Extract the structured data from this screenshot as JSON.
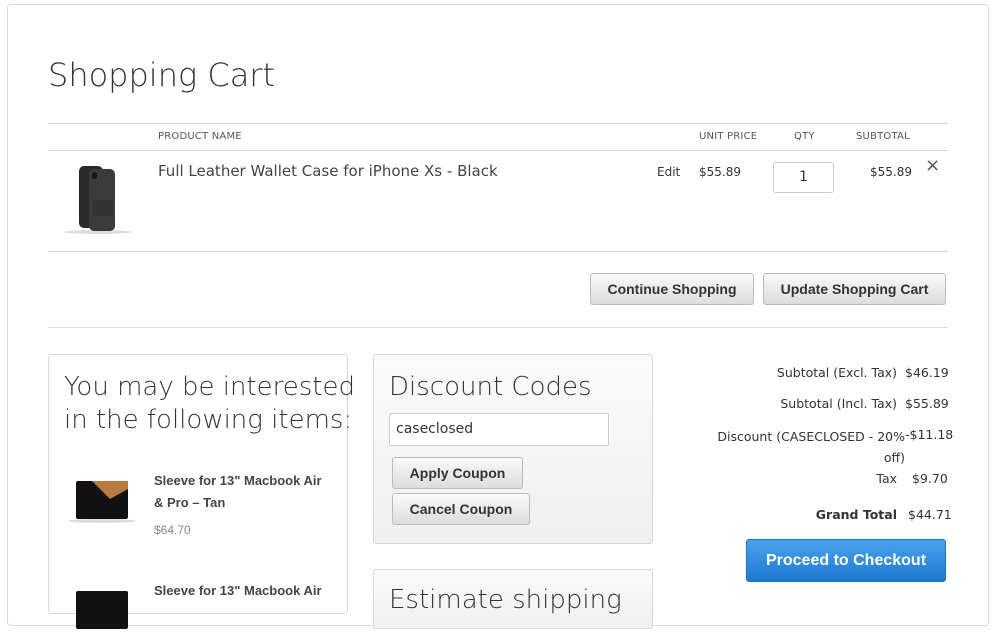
{
  "page": {
    "title": "Shopping Cart"
  },
  "table": {
    "headers": {
      "product": "PRODUCT NAME",
      "unit_price": "UNIT PRICE",
      "qty": "QTY",
      "subtotal": "SUBTOTAL"
    },
    "items": [
      {
        "name": "Full Leather Wallet Case for iPhone Xs - Black",
        "edit": "Edit",
        "price": "$55.89",
        "qty": "1",
        "subtotal": "$55.89",
        "remove": "×"
      }
    ]
  },
  "actions": {
    "continue": "Continue Shopping",
    "update": "Update Shopping Cart"
  },
  "related": {
    "title_line1": "You may be interested",
    "title_line2": "in the following items:",
    "items": [
      {
        "name_line1": "Sleeve for 13\" Macbook Air",
        "name_line2": "& Pro – Tan",
        "price": "$64.70"
      },
      {
        "name_line1": "Sleeve for 13\" Macbook Air"
      }
    ]
  },
  "discount": {
    "title": "Discount Codes",
    "code": "caseclosed",
    "apply": "Apply Coupon",
    "cancel": "Cancel Coupon"
  },
  "shipping": {
    "title": "Estimate shipping"
  },
  "totals": {
    "subtotal_excl_label": "Subtotal (Excl. Tax)",
    "subtotal_excl": "$46.19",
    "subtotal_incl_label": "Subtotal (Incl. Tax)",
    "subtotal_incl": "$55.89",
    "discount_label_line1": "Discount (CASECLOSED - 20%",
    "discount_label_line2": "off)",
    "discount": "-$11.18",
    "tax_label": "Tax",
    "tax": "$9.70",
    "grand_label": "Grand Total",
    "grand": "$44.71"
  },
  "checkout": {
    "label": "Proceed to Checkout"
  }
}
